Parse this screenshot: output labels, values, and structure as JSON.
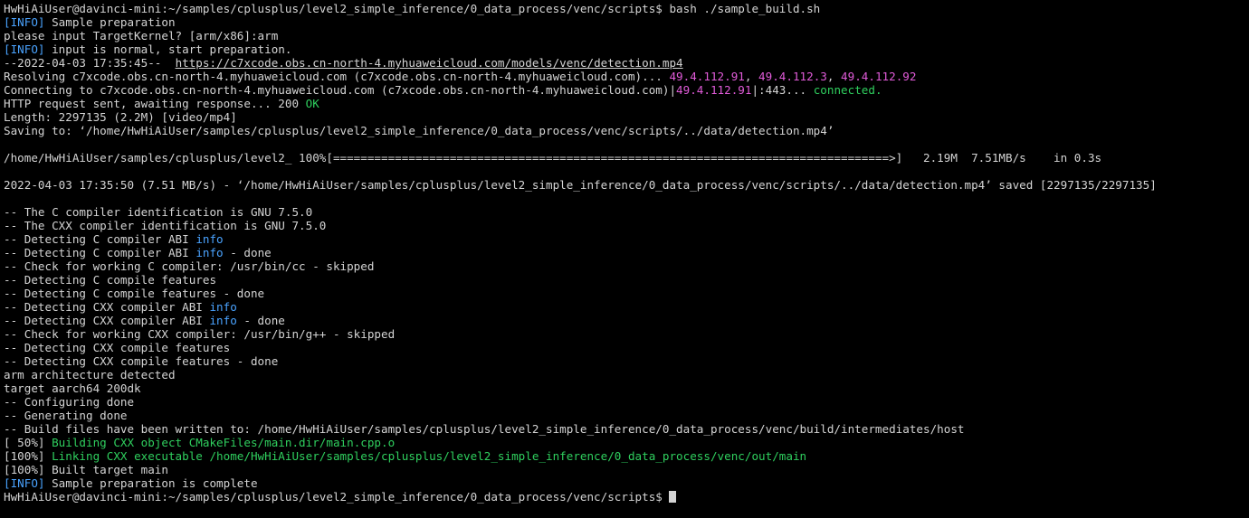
{
  "terminal": {
    "lines": [
      [
        {
          "t": "HwHiAiUser@davinci-mini:~/samples/cplusplus/level2_simple_inference/0_data_process/venc/scripts$ bash ./sample_build.sh",
          "c": "default"
        }
      ],
      [
        {
          "t": "[INFO]",
          "c": "blue"
        },
        {
          "t": " Sample preparation",
          "c": "default"
        }
      ],
      [
        {
          "t": "please input TargetKernel? [arm/x86]:arm",
          "c": "default"
        }
      ],
      [
        {
          "t": "[INFO]",
          "c": "blue"
        },
        {
          "t": " input is normal, start preparation.",
          "c": "default"
        }
      ],
      [
        {
          "t": "--2022-04-03 17:35:45--  ",
          "c": "default"
        },
        {
          "t": "https://c7xcode.obs.cn-north-4.myhuaweicloud.com/models/venc/detection.mp4",
          "c": "link"
        }
      ],
      [
        {
          "t": "Resolving c7xcode.obs.cn-north-4.myhuaweicloud.com (c7xcode.obs.cn-north-4.myhuaweicloud.com)... ",
          "c": "default"
        },
        {
          "t": "49.4.112.91",
          "c": "magenta"
        },
        {
          "t": ", ",
          "c": "default"
        },
        {
          "t": "49.4.112.3",
          "c": "magenta"
        },
        {
          "t": ", ",
          "c": "default"
        },
        {
          "t": "49.4.112.92",
          "c": "magenta"
        }
      ],
      [
        {
          "t": "Connecting to c7xcode.obs.cn-north-4.myhuaweicloud.com (c7xcode.obs.cn-north-4.myhuaweicloud.com)|",
          "c": "default"
        },
        {
          "t": "49.4.112.91",
          "c": "magenta"
        },
        {
          "t": "|:443... ",
          "c": "default"
        },
        {
          "t": "connected.",
          "c": "green"
        }
      ],
      [
        {
          "t": "HTTP request sent, awaiting response... 200 ",
          "c": "default"
        },
        {
          "t": "OK",
          "c": "green"
        }
      ],
      [
        {
          "t": "Length: 2297135 (2.2M) [video/mp4]",
          "c": "default"
        }
      ],
      [
        {
          "t": "Saving to: ‘/home/HwHiAiUser/samples/cplusplus/level2_simple_inference/0_data_process/venc/scripts/../data/detection.mp4’",
          "c": "default"
        }
      ],
      [
        {
          "t": "",
          "c": "default"
        }
      ],
      [
        {
          "t": "/home/HwHiAiUser/samples/cplusplus/level2_ 100%[=================================================================================>]   2.19M  7.51MB/s    in 0.3s",
          "c": "default"
        }
      ],
      [
        {
          "t": "",
          "c": "default"
        }
      ],
      [
        {
          "t": "2022-04-03 17:35:50 (7.51 MB/s) - ‘/home/HwHiAiUser/samples/cplusplus/level2_simple_inference/0_data_process/venc/scripts/../data/detection.mp4’ saved [2297135/2297135]",
          "c": "default"
        }
      ],
      [
        {
          "t": "",
          "c": "default"
        }
      ],
      [
        {
          "t": "-- The C compiler identification is GNU 7.5.0",
          "c": "default"
        }
      ],
      [
        {
          "t": "-- The CXX compiler identification is GNU 7.5.0",
          "c": "default"
        }
      ],
      [
        {
          "t": "-- Detecting C compiler ABI ",
          "c": "default"
        },
        {
          "t": "info",
          "c": "blue"
        }
      ],
      [
        {
          "t": "-- Detecting C compiler ABI ",
          "c": "default"
        },
        {
          "t": "info",
          "c": "blue"
        },
        {
          "t": " - done",
          "c": "default"
        }
      ],
      [
        {
          "t": "-- Check for working C compiler: /usr/bin/cc - skipped",
          "c": "default"
        }
      ],
      [
        {
          "t": "-- Detecting C compile features",
          "c": "default"
        }
      ],
      [
        {
          "t": "-- Detecting C compile features - done",
          "c": "default"
        }
      ],
      [
        {
          "t": "-- Detecting CXX compiler ABI ",
          "c": "default"
        },
        {
          "t": "info",
          "c": "blue"
        }
      ],
      [
        {
          "t": "-- Detecting CXX compiler ABI ",
          "c": "default"
        },
        {
          "t": "info",
          "c": "blue"
        },
        {
          "t": " - done",
          "c": "default"
        }
      ],
      [
        {
          "t": "-- Check for working CXX compiler: /usr/bin/g++ - skipped",
          "c": "default"
        }
      ],
      [
        {
          "t": "-- Detecting CXX compile features",
          "c": "default"
        }
      ],
      [
        {
          "t": "-- Detecting CXX compile features - done",
          "c": "default"
        }
      ],
      [
        {
          "t": "arm architecture detected",
          "c": "default"
        }
      ],
      [
        {
          "t": "target aarch64 200dk",
          "c": "default"
        }
      ],
      [
        {
          "t": "-- Configuring done",
          "c": "default"
        }
      ],
      [
        {
          "t": "-- Generating done",
          "c": "default"
        }
      ],
      [
        {
          "t": "-- Build files have been written to: /home/HwHiAiUser/samples/cplusplus/level2_simple_inference/0_data_process/venc/build/intermediates/host",
          "c": "default"
        }
      ],
      [
        {
          "t": "[ 50%] ",
          "c": "default"
        },
        {
          "t": "Building CXX object CMakeFiles/main.dir/main.cpp.o",
          "c": "green"
        }
      ],
      [
        {
          "t": "[100%] ",
          "c": "default"
        },
        {
          "t": "Linking CXX executable /home/HwHiAiUser/samples/cplusplus/level2_simple_inference/0_data_process/venc/out/main",
          "c": "green"
        }
      ],
      [
        {
          "t": "[100%] Built target main",
          "c": "default"
        }
      ],
      [
        {
          "t": "[INFO]",
          "c": "blue"
        },
        {
          "t": " Sample preparation is complete",
          "c": "default"
        }
      ],
      [
        {
          "t": "HwHiAiUser@davinci-mini:~/samples/cplusplus/level2_simple_inference/0_data_process/venc/scripts$ ",
          "c": "default"
        }
      ]
    ]
  }
}
